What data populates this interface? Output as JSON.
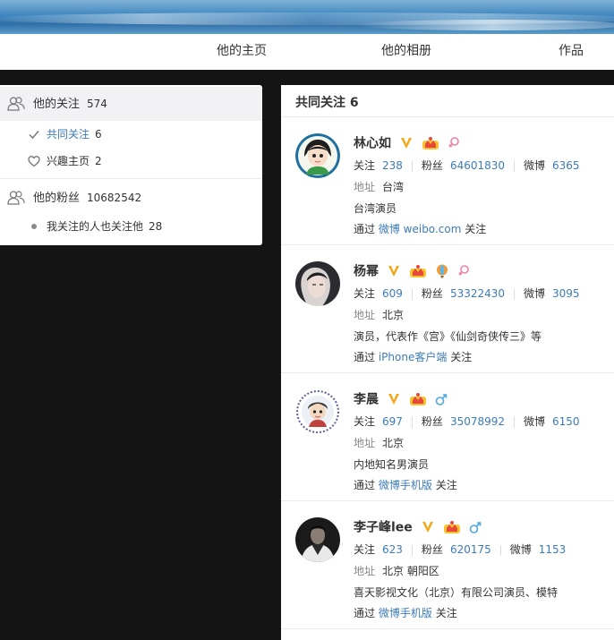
{
  "nav": {
    "items": [
      {
        "label": "他的主页"
      },
      {
        "label": "他的相册"
      },
      {
        "label": "作品"
      }
    ]
  },
  "sidebar": {
    "following": {
      "label": "他的关注",
      "count": "574"
    },
    "common": {
      "label": "共同关注",
      "count": "6"
    },
    "interest": {
      "label": "兴趣主页",
      "count": "2"
    },
    "fans": {
      "label": "他的粉丝",
      "count": "10682542"
    },
    "mutual": {
      "label": "我关注的人也关注他",
      "count": "28"
    }
  },
  "main": {
    "title": "共同关注 6",
    "labels": {
      "follow": "关注",
      "fans": "粉丝",
      "weibo": "微博",
      "address": "地址",
      "via": "通过",
      "followed": "关注"
    },
    "users": [
      {
        "name": "林心如",
        "gender": "female",
        "follow": "238",
        "fans": "64601830",
        "weibo": "6365",
        "address": "台湾",
        "bio": "台湾演员",
        "source": "微博 weibo.com"
      },
      {
        "name": "杨幂",
        "gender": "female",
        "follow": "609",
        "fans": "53322430",
        "weibo": "3095",
        "address": "北京",
        "bio": "演员，代表作《宫》《仙剑奇侠传三》等",
        "source": "iPhone客户端"
      },
      {
        "name": "李晨",
        "gender": "male",
        "follow": "697",
        "fans": "35078992",
        "weibo": "6150",
        "address": "北京",
        "bio": "内地知名男演员",
        "source": "微博手机版"
      },
      {
        "name": "李子峰lee",
        "gender": "male",
        "follow": "623",
        "fans": "620175",
        "weibo": "1153",
        "address": "北京 朝阳区",
        "bio": "喜天影视文化（北京）有限公司演员、模特",
        "source": "微博手机版"
      }
    ]
  },
  "colors": {
    "link": "#3d7bb7",
    "verified": "#f3a712",
    "female": "#f27fa5",
    "male": "#4fa8e0",
    "crown": "#e8473c"
  }
}
